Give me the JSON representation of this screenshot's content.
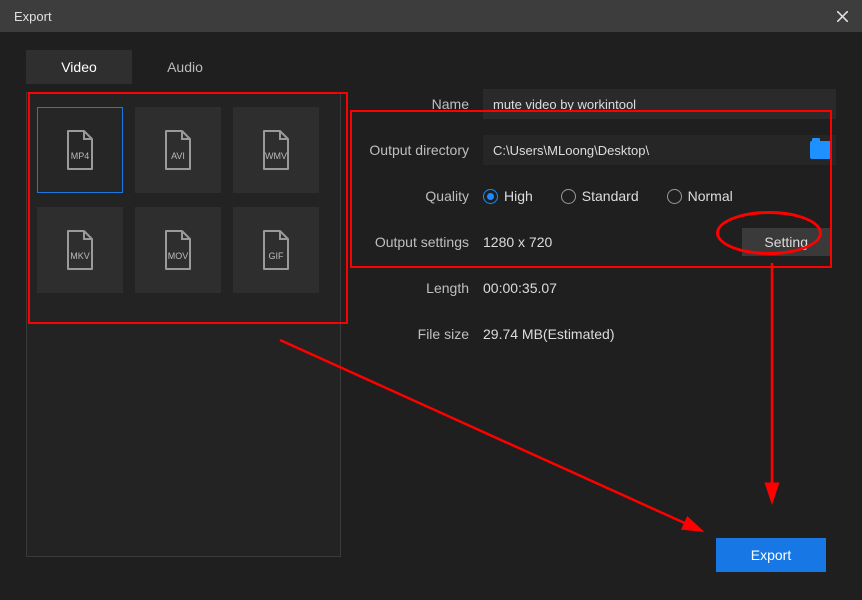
{
  "window": {
    "title": "Export"
  },
  "tabs": {
    "video": "Video",
    "audio": "Audio"
  },
  "formats": [
    {
      "code": "MP4",
      "selected": true
    },
    {
      "code": "AVI",
      "selected": false
    },
    {
      "code": "WMV",
      "selected": false
    },
    {
      "code": "MKV",
      "selected": false
    },
    {
      "code": "MOV",
      "selected": false
    },
    {
      "code": "GIF",
      "selected": false
    }
  ],
  "fields": {
    "name": {
      "label": "Name",
      "value": "mute video by workintool"
    },
    "output_dir": {
      "label": "Output directory",
      "value": "C:\\Users\\MLoong\\Desktop\\"
    },
    "quality": {
      "label": "Quality",
      "options": {
        "high": "High",
        "standard": "Standard",
        "normal": "Normal"
      },
      "selected": "high"
    },
    "output_settings": {
      "label": "Output settings",
      "value": "1280 x 720",
      "button": "Setting"
    },
    "length": {
      "label": "Length",
      "value": "00:00:35.07"
    },
    "filesize": {
      "label": "File size",
      "value": "29.74 MB(Estimated)"
    }
  },
  "buttons": {
    "export": "Export"
  }
}
